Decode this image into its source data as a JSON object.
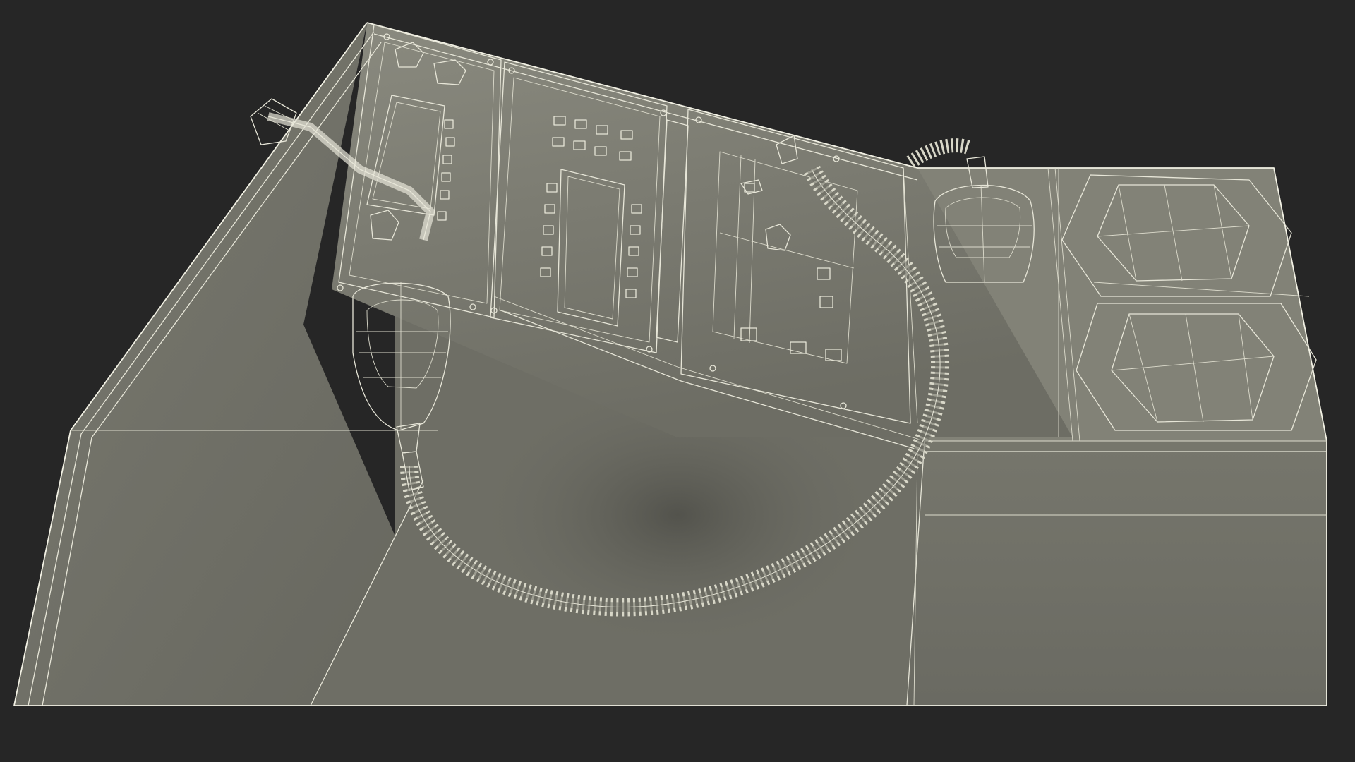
{
  "scene": {
    "subject": "wireframe-console",
    "colors": {
      "background": "#262626",
      "surface_light": "#7d7d72",
      "surface_mid": "#6f6f66",
      "surface_dark": "#55554e",
      "hole_dark": "#2e2e2b",
      "wire": "#e7e6d8"
    },
    "components": {
      "cup_holder_count": 2,
      "microphone_count": 2,
      "radio_panel_count": 2
    }
  }
}
